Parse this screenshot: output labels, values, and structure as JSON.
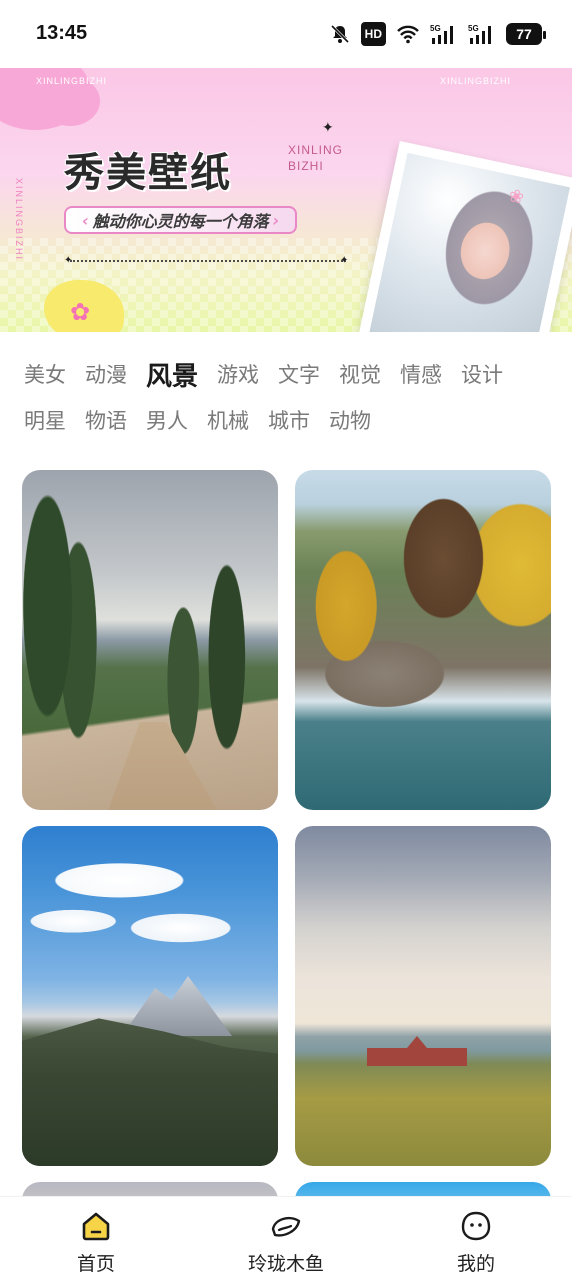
{
  "status_bar": {
    "time": "13:45",
    "hd_label": "HD",
    "battery": "77",
    "icons": [
      "mute-bell-icon",
      "hd-icon",
      "wifi-icon",
      "5g-signal-icon",
      "5g-signal-icon",
      "battery-icon"
    ]
  },
  "banner": {
    "title": "秀美壁纸",
    "subtitle": "触动你心灵的每一个角落",
    "en_line1": "XINLING",
    "en_line2": "BIZHI",
    "corner_text_left": "XINLINGBIZHI",
    "corner_text_right": "XINLINGBIZHI",
    "vertical_text": "XINLINGBIZHI",
    "colors": {
      "pink": "#fbc7e6",
      "yellow": "#e9f7a8",
      "accent": "#e988c7"
    }
  },
  "categories": {
    "row1": [
      "美女",
      "动漫",
      "风景",
      "游戏",
      "文字",
      "视觉",
      "情感",
      "设计"
    ],
    "row2": [
      "明星",
      "物语",
      "男人",
      "机械",
      "城市",
      "动物"
    ],
    "active": "风景"
  },
  "wallpapers": [
    {
      "id": "card-1",
      "scene": "forest-road"
    },
    {
      "id": "card-2",
      "scene": "mill-waterfall"
    },
    {
      "id": "card-3",
      "scene": "mountain-sky"
    },
    {
      "id": "card-4",
      "scene": "prairie-barn"
    }
  ],
  "bottom_nav": {
    "items": [
      {
        "label": "首页",
        "icon": "home-icon",
        "active": true
      },
      {
        "label": "玲珑木鱼",
        "icon": "wooden-fish-icon",
        "active": false
      },
      {
        "label": "我的",
        "icon": "profile-face-icon",
        "active": false
      }
    ],
    "active_color": "#f7d447"
  }
}
